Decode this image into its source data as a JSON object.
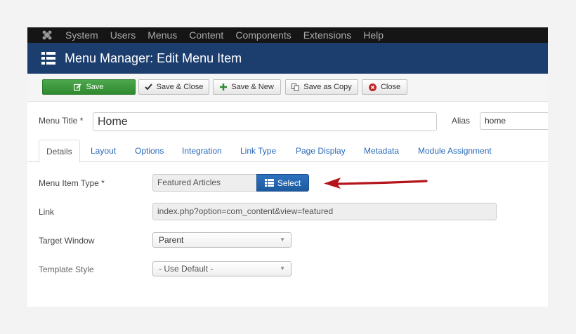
{
  "nav": {
    "items": [
      "System",
      "Users",
      "Menus",
      "Content",
      "Components",
      "Extensions",
      "Help"
    ]
  },
  "header": {
    "title": "Menu Manager: Edit Menu Item"
  },
  "toolbar": {
    "save": "Save",
    "save_close": "Save & Close",
    "save_new": "Save & New",
    "save_copy": "Save as Copy",
    "close": "Close"
  },
  "form": {
    "menu_title_label": "Menu Title *",
    "menu_title_value": "Home",
    "alias_label": "Alias",
    "alias_value": "home",
    "menu_item_type_label": "Menu Item Type *",
    "menu_item_type_value": "Featured Articles",
    "select_button": "Select",
    "link_label": "Link",
    "link_value": "index.php?option=com_content&view=featured",
    "target_window_label": "Target Window",
    "target_window_value": "Parent",
    "template_style_label": "Template Style",
    "template_style_value": "- Use Default -"
  },
  "tabs": [
    "Details",
    "Layout",
    "Options",
    "Integration",
    "Link Type",
    "Page Display",
    "Metadata",
    "Module Assignment"
  ],
  "colors": {
    "navbar": "#151515",
    "titlebar": "#1b3e6f",
    "save_green": "#3c9a3c",
    "select_blue": "#2566ae",
    "arrow_red": "#b5141b",
    "link_blue": "#2a69b8"
  }
}
